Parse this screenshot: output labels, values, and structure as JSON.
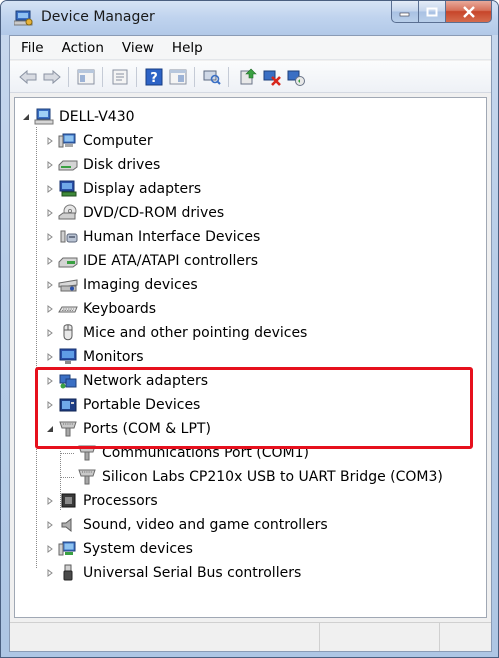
{
  "window": {
    "title": "Device Manager"
  },
  "menu": {
    "items": [
      "File",
      "Action",
      "View",
      "Help"
    ]
  },
  "toolbar": {
    "buttons": [
      {
        "icon": "back-arrow-icon"
      },
      {
        "icon": "forward-arrow-icon"
      },
      {
        "icon": "show-hide-console-tree-icon"
      },
      {
        "icon": "properties-icon"
      },
      {
        "icon": "help-icon"
      },
      {
        "icon": "view-icon"
      },
      {
        "icon": "scan-hardware-icon"
      },
      {
        "icon": "update-driver-icon"
      },
      {
        "icon": "uninstall-icon"
      },
      {
        "icon": "enable-device-icon"
      }
    ]
  },
  "tree": {
    "root": "DELL-V430",
    "categories": [
      "Computer",
      "Disk drives",
      "Display adapters",
      "DVD/CD-ROM drives",
      "Human Interface Devices",
      "IDE ATA/ATAPI controllers",
      "Imaging devices",
      "Keyboards",
      "Mice and other pointing devices",
      "Monitors",
      "Network adapters",
      "Portable Devices",
      "Ports (COM & LPT)",
      "Processors",
      "Sound, video and game controllers",
      "System devices",
      "Universal Serial Bus controllers"
    ],
    "ports_children": [
      "Communications Port (COM1)",
      "Silicon Labs CP210x USB to UART Bridge (COM3)"
    ]
  },
  "colors": {
    "highlight": "#e6101d",
    "title_bar": "#bfd3ee",
    "close_button": "#c7452a"
  }
}
